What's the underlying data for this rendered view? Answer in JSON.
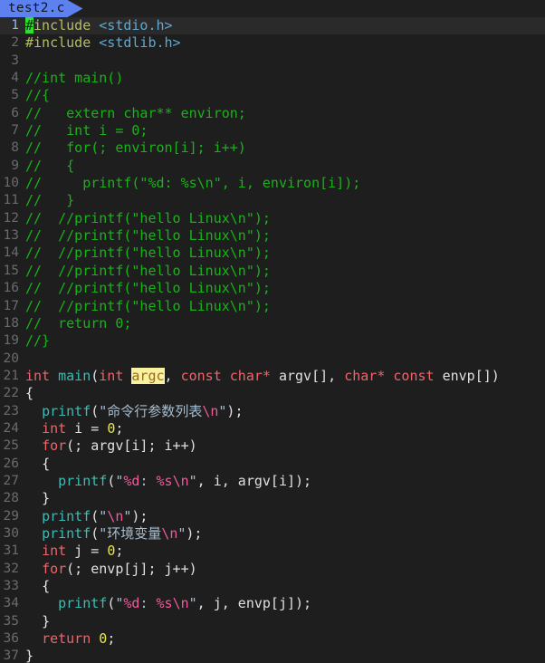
{
  "window": {
    "background": "#1e1e1e",
    "accent": "#5d82f0"
  },
  "tabbar": {
    "tabs": [
      {
        "label": "test2.c",
        "active": true
      }
    ]
  },
  "editor": {
    "language": "c",
    "cursor": {
      "line": 1,
      "column": 1,
      "character": "#"
    },
    "highlight_term": "argc",
    "colors": {
      "background": "#1e1e1e",
      "current_line": "#2a2a2a",
      "gutter_text": "#6b6b6b",
      "gutter_active": "#8fb8e8",
      "preprocessor": "#b5bd68",
      "header": "#5fa8d3",
      "comment": "#19b319",
      "keyword": "#f0646b",
      "function": "#3bbdb3",
      "string": "#a7bdd0",
      "escape": "#ef5b9c",
      "number": "#e8e84a",
      "plain": "#e0e0e0",
      "occurrence_bg": "#f7f1a0",
      "occurrence_fg": "#9a6a1a",
      "cursor_bg": "#2ee02e"
    },
    "lines": [
      {
        "n": "1",
        "current": true,
        "tokens": [
          {
            "c": "t-pre t-cursor",
            "t": "#"
          },
          {
            "c": "t-pre",
            "t": "include"
          },
          {
            "c": "t-plain",
            "t": " "
          },
          {
            "c": "t-hdr",
            "t": "<stdio.h>"
          }
        ]
      },
      {
        "n": "2",
        "current": false,
        "tokens": [
          {
            "c": "t-pre",
            "t": "#include"
          },
          {
            "c": "t-plain",
            "t": " "
          },
          {
            "c": "t-hdr",
            "t": "<stdlib.h>"
          }
        ]
      },
      {
        "n": "3",
        "current": false,
        "tokens": []
      },
      {
        "n": "4",
        "current": false,
        "tokens": [
          {
            "c": "t-cmt",
            "t": "//int main()"
          }
        ]
      },
      {
        "n": "5",
        "current": false,
        "tokens": [
          {
            "c": "t-cmt",
            "t": "//{"
          }
        ]
      },
      {
        "n": "6",
        "current": false,
        "tokens": [
          {
            "c": "t-cmt",
            "t": "//   extern char** environ;"
          }
        ]
      },
      {
        "n": "7",
        "current": false,
        "tokens": [
          {
            "c": "t-cmt",
            "t": "//   int i = 0;"
          }
        ]
      },
      {
        "n": "8",
        "current": false,
        "tokens": [
          {
            "c": "t-cmt",
            "t": "//   for(; environ[i]; i++)"
          }
        ]
      },
      {
        "n": "9",
        "current": false,
        "tokens": [
          {
            "c": "t-cmt",
            "t": "//   {"
          }
        ]
      },
      {
        "n": "10",
        "current": false,
        "tokens": [
          {
            "c": "t-cmt",
            "t": "//     printf(\"%d: %s\\n\", i, environ[i]);"
          }
        ]
      },
      {
        "n": "11",
        "current": false,
        "tokens": [
          {
            "c": "t-cmt",
            "t": "//   }"
          }
        ]
      },
      {
        "n": "12",
        "current": false,
        "tokens": [
          {
            "c": "t-cmt",
            "t": "//  //printf(\"hello Linux\\n\");"
          }
        ]
      },
      {
        "n": "13",
        "current": false,
        "tokens": [
          {
            "c": "t-cmt",
            "t": "//  //printf(\"hello Linux\\n\");"
          }
        ]
      },
      {
        "n": "14",
        "current": false,
        "tokens": [
          {
            "c": "t-cmt",
            "t": "//  //printf(\"hello Linux\\n\");"
          }
        ]
      },
      {
        "n": "15",
        "current": false,
        "tokens": [
          {
            "c": "t-cmt",
            "t": "//  //printf(\"hello Linux\\n\");"
          }
        ]
      },
      {
        "n": "16",
        "current": false,
        "tokens": [
          {
            "c": "t-cmt",
            "t": "//  //printf(\"hello Linux\\n\");"
          }
        ]
      },
      {
        "n": "17",
        "current": false,
        "tokens": [
          {
            "c": "t-cmt",
            "t": "//  //printf(\"hello Linux\\n\");"
          }
        ]
      },
      {
        "n": "18",
        "current": false,
        "tokens": [
          {
            "c": "t-cmt",
            "t": "//  return 0;"
          }
        ]
      },
      {
        "n": "19",
        "current": false,
        "tokens": [
          {
            "c": "t-cmt",
            "t": "//}"
          }
        ]
      },
      {
        "n": "20",
        "current": false,
        "tokens": []
      },
      {
        "n": "21",
        "current": false,
        "tokens": [
          {
            "c": "t-kw",
            "t": "int"
          },
          {
            "c": "t-plain",
            "t": " "
          },
          {
            "c": "t-fn",
            "t": "main"
          },
          {
            "c": "t-plain",
            "t": "("
          },
          {
            "c": "t-kw",
            "t": "int"
          },
          {
            "c": "t-plain",
            "t": " "
          },
          {
            "c": "t-hl",
            "t": "argc"
          },
          {
            "c": "t-plain",
            "t": ", "
          },
          {
            "c": "t-kw",
            "t": "const"
          },
          {
            "c": "t-plain",
            "t": " "
          },
          {
            "c": "t-kw",
            "t": "char*"
          },
          {
            "c": "t-plain",
            "t": " argv[], "
          },
          {
            "c": "t-kw",
            "t": "char*"
          },
          {
            "c": "t-plain",
            "t": " "
          },
          {
            "c": "t-kw",
            "t": "const"
          },
          {
            "c": "t-plain",
            "t": " envp[])"
          }
        ]
      },
      {
        "n": "22",
        "current": false,
        "tokens": [
          {
            "c": "t-brace",
            "t": "{"
          }
        ]
      },
      {
        "n": "23",
        "current": false,
        "tokens": [
          {
            "c": "t-plain",
            "t": "  "
          },
          {
            "c": "t-fn",
            "t": "printf"
          },
          {
            "c": "t-plain",
            "t": "("
          },
          {
            "c": "t-str",
            "t": "\"命令行参数列表"
          },
          {
            "c": "t-esc",
            "t": "\\n"
          },
          {
            "c": "t-str",
            "t": "\""
          },
          {
            "c": "t-plain",
            "t": ");"
          }
        ]
      },
      {
        "n": "24",
        "current": false,
        "tokens": [
          {
            "c": "t-plain",
            "t": "  "
          },
          {
            "c": "t-kw",
            "t": "int"
          },
          {
            "c": "t-plain",
            "t": " i = "
          },
          {
            "c": "t-num",
            "t": "0"
          },
          {
            "c": "t-plain",
            "t": ";"
          }
        ]
      },
      {
        "n": "25",
        "current": false,
        "tokens": [
          {
            "c": "t-plain",
            "t": "  "
          },
          {
            "c": "t-kw",
            "t": "for"
          },
          {
            "c": "t-plain",
            "t": "(; argv[i]; i++)"
          }
        ]
      },
      {
        "n": "26",
        "current": false,
        "tokens": [
          {
            "c": "t-plain",
            "t": "  "
          },
          {
            "c": "t-brace",
            "t": "{"
          }
        ]
      },
      {
        "n": "27",
        "current": false,
        "tokens": [
          {
            "c": "t-plain",
            "t": "    "
          },
          {
            "c": "t-fn",
            "t": "printf"
          },
          {
            "c": "t-plain",
            "t": "("
          },
          {
            "c": "t-str",
            "t": "\""
          },
          {
            "c": "t-esc",
            "t": "%d"
          },
          {
            "c": "t-str",
            "t": ": "
          },
          {
            "c": "t-esc",
            "t": "%s"
          },
          {
            "c": "t-esc",
            "t": "\\n"
          },
          {
            "c": "t-str",
            "t": "\""
          },
          {
            "c": "t-plain",
            "t": ", i, argv[i]);"
          }
        ]
      },
      {
        "n": "28",
        "current": false,
        "tokens": [
          {
            "c": "t-plain",
            "t": "  "
          },
          {
            "c": "t-brace",
            "t": "}"
          }
        ]
      },
      {
        "n": "29",
        "current": false,
        "tokens": [
          {
            "c": "t-plain",
            "t": "  "
          },
          {
            "c": "t-fn",
            "t": "printf"
          },
          {
            "c": "t-plain",
            "t": "("
          },
          {
            "c": "t-str",
            "t": "\""
          },
          {
            "c": "t-esc",
            "t": "\\n"
          },
          {
            "c": "t-str",
            "t": "\""
          },
          {
            "c": "t-plain",
            "t": ");"
          }
        ]
      },
      {
        "n": "30",
        "current": false,
        "tokens": [
          {
            "c": "t-plain",
            "t": "  "
          },
          {
            "c": "t-fn",
            "t": "printf"
          },
          {
            "c": "t-plain",
            "t": "("
          },
          {
            "c": "t-str",
            "t": "\"环境变量"
          },
          {
            "c": "t-esc",
            "t": "\\n"
          },
          {
            "c": "t-str",
            "t": "\""
          },
          {
            "c": "t-plain",
            "t": ");"
          }
        ]
      },
      {
        "n": "31",
        "current": false,
        "tokens": [
          {
            "c": "t-plain",
            "t": "  "
          },
          {
            "c": "t-kw",
            "t": "int"
          },
          {
            "c": "t-plain",
            "t": " j = "
          },
          {
            "c": "t-num",
            "t": "0"
          },
          {
            "c": "t-plain",
            "t": ";"
          }
        ]
      },
      {
        "n": "32",
        "current": false,
        "tokens": [
          {
            "c": "t-plain",
            "t": "  "
          },
          {
            "c": "t-kw",
            "t": "for"
          },
          {
            "c": "t-plain",
            "t": "(; envp[j]; j++)"
          }
        ]
      },
      {
        "n": "33",
        "current": false,
        "tokens": [
          {
            "c": "t-plain",
            "t": "  "
          },
          {
            "c": "t-brace",
            "t": "{"
          }
        ]
      },
      {
        "n": "34",
        "current": false,
        "tokens": [
          {
            "c": "t-plain",
            "t": "    "
          },
          {
            "c": "t-fn",
            "t": "printf"
          },
          {
            "c": "t-plain",
            "t": "("
          },
          {
            "c": "t-str",
            "t": "\""
          },
          {
            "c": "t-esc",
            "t": "%d"
          },
          {
            "c": "t-str",
            "t": ": "
          },
          {
            "c": "t-esc",
            "t": "%s"
          },
          {
            "c": "t-esc",
            "t": "\\n"
          },
          {
            "c": "t-str",
            "t": "\""
          },
          {
            "c": "t-plain",
            "t": ", j, envp[j]);"
          }
        ]
      },
      {
        "n": "35",
        "current": false,
        "tokens": [
          {
            "c": "t-plain",
            "t": "  "
          },
          {
            "c": "t-brace",
            "t": "}"
          }
        ]
      },
      {
        "n": "36",
        "current": false,
        "tokens": [
          {
            "c": "t-plain",
            "t": "  "
          },
          {
            "c": "t-kw",
            "t": "return"
          },
          {
            "c": "t-plain",
            "t": " "
          },
          {
            "c": "t-num",
            "t": "0"
          },
          {
            "c": "t-plain",
            "t": ";"
          }
        ]
      },
      {
        "n": "37",
        "current": false,
        "tokens": [
          {
            "c": "t-brace",
            "t": "}"
          }
        ]
      }
    ]
  }
}
